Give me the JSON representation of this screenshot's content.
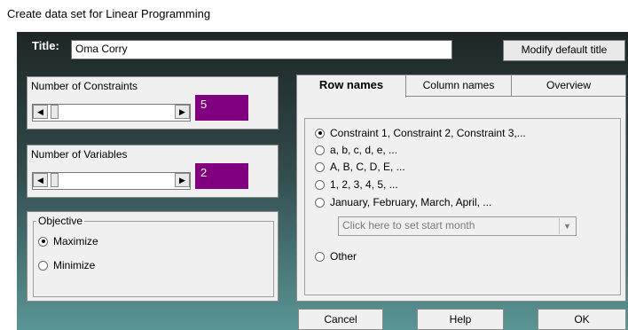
{
  "window": {
    "title": "Create data set for Linear Programming"
  },
  "title_row": {
    "label": "Title:",
    "value": "Oma Corry",
    "modify_button": "Modify default title"
  },
  "constraints": {
    "label": "Number of Constraints",
    "value": "5"
  },
  "variables": {
    "label": "Number of Variables",
    "value": "2"
  },
  "objective": {
    "label": "Objective",
    "options": [
      {
        "label": "Maximize",
        "selected": true
      },
      {
        "label": "Minimize",
        "selected": false
      }
    ]
  },
  "tabs": [
    {
      "label": "Row names",
      "active": true
    },
    {
      "label": "Column names",
      "active": false
    },
    {
      "label": "Overview",
      "active": false
    }
  ],
  "row_names": {
    "options": [
      {
        "label": "Constraint 1, Constraint 2, Constraint 3,...",
        "selected": true
      },
      {
        "label": "a, b, c, d, e, ...",
        "selected": false
      },
      {
        "label": "A, B, C, D, E, ...",
        "selected": false
      },
      {
        "label": "1, 2, 3, 4, 5, ...",
        "selected": false
      },
      {
        "label": "January, February, March, April, ...",
        "selected": false
      },
      {
        "label": "Other",
        "selected": false
      }
    ],
    "month_select": "Click here to set start month"
  },
  "buttons": {
    "cancel": "Cancel",
    "help": "Help",
    "ok": "OK"
  },
  "colors": {
    "value_box": "#800080",
    "dialog_top": "#1e2626",
    "dialog_bottom": "#5a9595"
  },
  "icons": {
    "scroll_left": "arrow-left-icon",
    "scroll_right": "arrow-right-icon",
    "dropdown": "chevron-down-icon"
  }
}
